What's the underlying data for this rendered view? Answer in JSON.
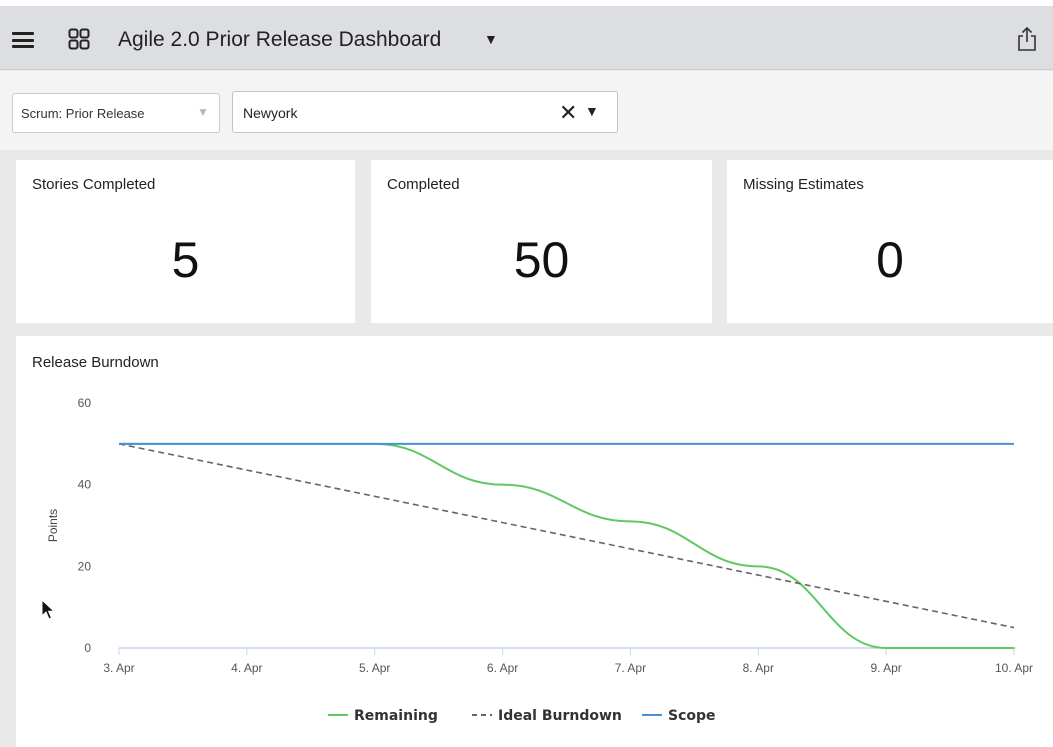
{
  "header": {
    "title": "Agile 2.0 Prior Release Dashboard",
    "menu_icon": "hamburger-menu-icon",
    "apps_icon": "grid-icon",
    "title_caret": "▼",
    "share_icon": "share-icon"
  },
  "filters": {
    "team": {
      "value": "Scrum: Prior Release",
      "caret": "▼"
    },
    "location": {
      "value": "Newyork",
      "clear": "✕",
      "caret": "▼"
    }
  },
  "cards": [
    {
      "label": "Stories Completed",
      "value": "5"
    },
    {
      "label": "Completed",
      "value": "50"
    },
    {
      "label": "Missing Estimates",
      "value": "0"
    }
  ],
  "chart_data": {
    "type": "line",
    "title": "Release Burndown",
    "ylabel": "Points",
    "xlabel": "",
    "ylim": [
      0,
      60
    ],
    "yticks": [
      0,
      20,
      40,
      60
    ],
    "categories": [
      "3. Apr",
      "4. Apr",
      "5. Apr",
      "6. Apr",
      "7. Apr",
      "8. Apr",
      "9. Apr",
      "10. Apr"
    ],
    "series": [
      {
        "name": "Remaining",
        "color": "#5ec962",
        "style": "solid",
        "values": [
          50,
          50,
          50,
          40,
          31,
          20,
          0,
          0
        ]
      },
      {
        "name": "Ideal Burndown",
        "color": "#666666",
        "style": "dashed",
        "values": [
          50,
          43.6,
          37.1,
          30.7,
          24.3,
          17.9,
          11.4,
          5
        ]
      },
      {
        "name": "Scope",
        "color": "#4a90d9",
        "style": "solid",
        "values": [
          50,
          50,
          50,
          50,
          50,
          50,
          50,
          50
        ]
      }
    ],
    "legend": "bottom-center",
    "grid": false
  },
  "colors": {
    "titlebar_bg": "#dcdee1",
    "page_bg": "#e9e9ea",
    "remaining": "#5ec962",
    "ideal": "#666666",
    "scope": "#4a90d9"
  }
}
